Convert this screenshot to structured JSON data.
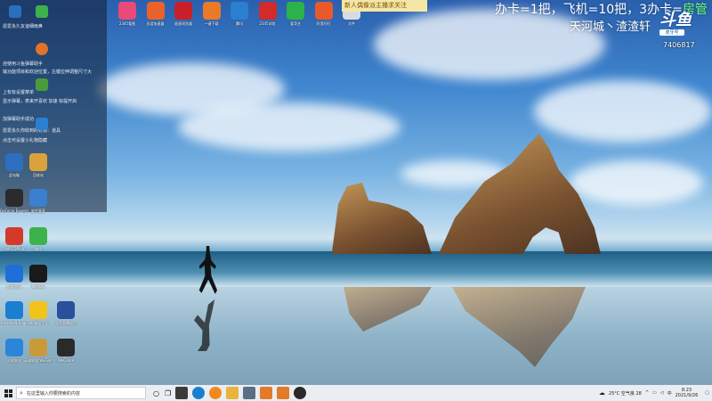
{
  "window": {
    "ticker": "新人偶像派主播求关注"
  },
  "overlay_banner": {
    "prefix": "办卡=1把，飞机=10把，3办卡=",
    "suffix": "房管"
  },
  "channel": {
    "name": "天河城丶渣渣轩",
    "room_id": "7406817",
    "logo_mark": "斗鱼",
    "logo_tag": "虎牙号"
  },
  "overlay_panel": {
    "lines": [
      "恩爱永久友谊细雨鼻",
      "迎使用斗鱼弹幕助手",
      "输功能项目和欢迎位置，左键拉伸调整尺寸大",
      "上有有设置菜单",
      "显示弹幕，表来开喜欢 加速 标提开启",
      "加弹幕助手成功",
      "恩爱永久你收到的礼物：道具",
      "点击可设置小礼物隐藏"
    ]
  },
  "desktop_icons_top": [
    "2345看图",
    "迅游加速器",
    "极速浏览器",
    "一键下载",
    "腾讯",
    "2345浏览",
    "爱奇艺",
    "阿里旺旺",
    "文件"
  ],
  "desktop_icons_left": [
    {
      "label": "此电脑",
      "color": "#2c6fbf"
    },
    {
      "label": "回收站",
      "color": "#d9a33a"
    },
    {
      "label": "GeForce Experience",
      "color": "#2b2b2b"
    },
    {
      "label": "软件管家",
      "color": "#3a7fd0"
    },
    {
      "label": "WPS Office",
      "color": "#d43a2a"
    },
    {
      "label": "微信",
      "color": "#3cb24a"
    },
    {
      "label": "酷狗音乐",
      "color": "#1f6fd6"
    },
    {
      "label": "腾讯QQ",
      "color": "#1a1a1a"
    },
    {
      "label": "Microsoft Edge",
      "color": "#1b7fd1"
    },
    {
      "label": "360安全卫士",
      "color": "#f0c419"
    },
    {
      "label": "斗鱼直播伴侣",
      "color": "#2a4f9c"
    },
    {
      "label": "火绒安全",
      "color": "#2b86d8"
    },
    {
      "label": "英雄联盟 WeGame",
      "color": "#c99a3a"
    },
    {
      "label": "WeGame",
      "color": "#2a2a2a"
    }
  ],
  "taskbar": {
    "search_placeholder": "在这里输入你要搜索的内容",
    "weather": "25°C 空气良 28",
    "input_method": "中",
    "time": "8:23",
    "date": "2021/9/26"
  }
}
